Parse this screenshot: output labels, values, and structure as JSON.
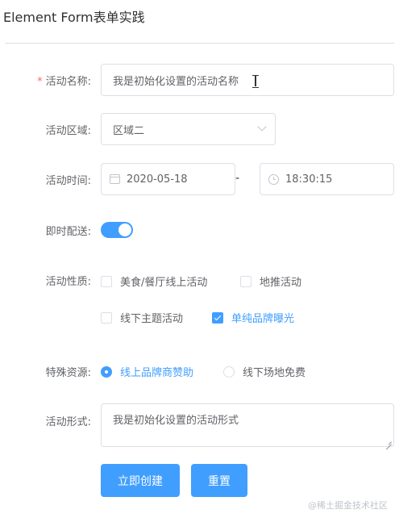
{
  "page_title": "Element Form表单实践",
  "colors": {
    "primary": "#409eff",
    "required": "#f56c6c",
    "border": "#dcdfe6",
    "text": "#606266"
  },
  "form": {
    "name": {
      "label": "活动名称:",
      "required_mark": "*",
      "value": "我是初始化设置的活动名称"
    },
    "region": {
      "label": "活动区域:",
      "value": "区域二",
      "icon": "chevron-down-icon"
    },
    "time": {
      "label": "活动时间:",
      "date": "2020-05-18",
      "separator": "-",
      "time": "18:30:15",
      "date_icon": "calendar-icon",
      "time_icon": "clock-icon"
    },
    "delivery": {
      "label": "即时配送:",
      "on": true
    },
    "type": {
      "label": "活动性质:",
      "options": [
        {
          "label": "美食/餐厅线上活动",
          "checked": false
        },
        {
          "label": "地推活动",
          "checked": false
        },
        {
          "label": "线下主题活动",
          "checked": false
        },
        {
          "label": "单纯品牌曝光",
          "checked": true
        }
      ]
    },
    "resource": {
      "label": "特殊资源:",
      "options": [
        {
          "label": "线上品牌商赞助",
          "checked": true
        },
        {
          "label": "线下场地免费",
          "checked": false
        }
      ]
    },
    "desc": {
      "label": "活动形式:",
      "value": "我是初始化设置的活动形式"
    }
  },
  "buttons": {
    "create": "立即创建",
    "reset": "重置"
  },
  "watermark": "@稀土掘金技术社区"
}
